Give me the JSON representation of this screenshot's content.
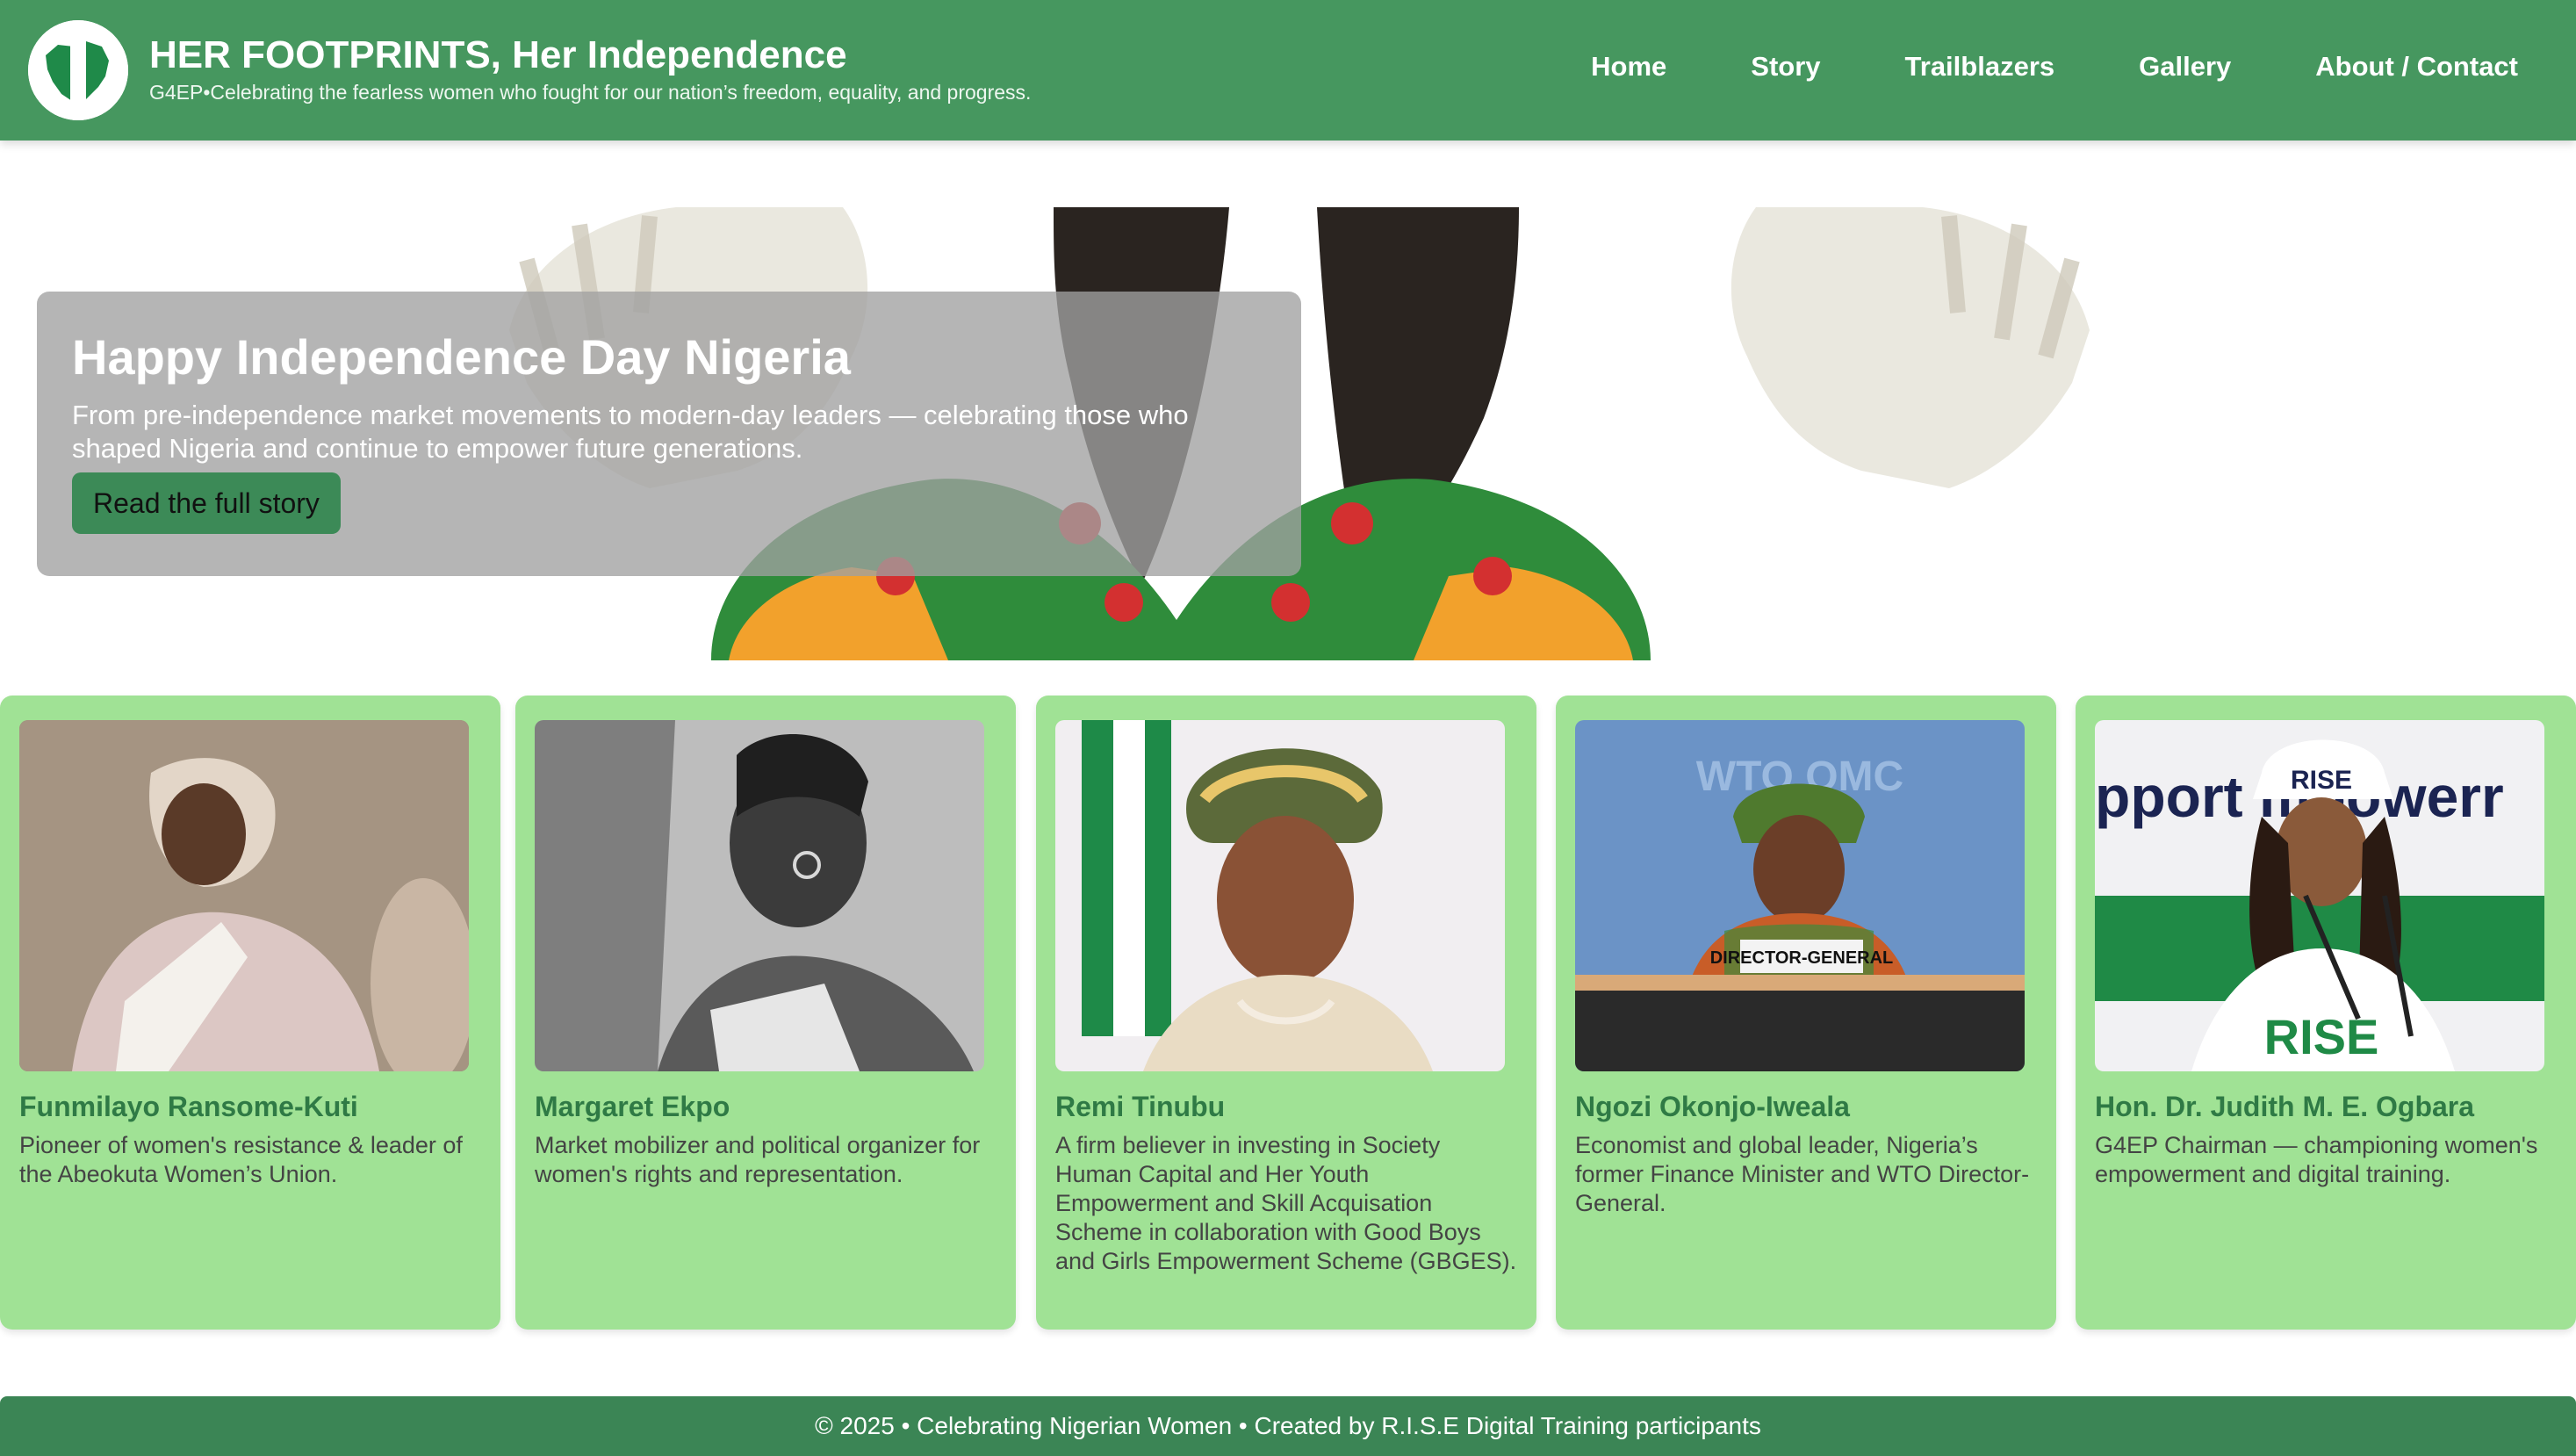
{
  "header": {
    "title": "HER FOOTPRINTS, Her Independence",
    "tagline": "G4EP•Celebrating the fearless women who fought for our nation’s freedom, equality, and progress.",
    "logo_icon": "nigeria-map-icon"
  },
  "nav": {
    "items": [
      {
        "label": "Home"
      },
      {
        "label": "Story"
      },
      {
        "label": "Trailblazers"
      },
      {
        "label": "Gallery"
      },
      {
        "label": "About / Contact"
      }
    ]
  },
  "hero": {
    "title": "Happy Independence Day Nigeria",
    "text": "From pre-independence market movements to modern-day leaders — celebrating those who shaped Nigeria and continue to empower future generations.",
    "button_label": "Read the full story",
    "image": "nigeria-coat-of-arms"
  },
  "cards": [
    {
      "name": "Funmilayo Ransome-Kuti",
      "desc": "Pioneer of women's resistance & leader of the Abeokuta Women’s Union."
    },
    {
      "name": "Margaret Ekpo",
      "desc": "Market mobilizer and political organizer for women's rights and representation."
    },
    {
      "name": "Remi Tinubu",
      "desc": "A firm believer in investing in Society Human Capital and Her Youth Empowerment and Skill Acquisation Scheme in collaboration with Good Boys and Girls Empowerment Scheme (GBGES)."
    },
    {
      "name": "Ngozi Okonjo-Iweala",
      "desc": "Economist and global leader, Nigeria’s former Finance Minister and WTO Director-General."
    },
    {
      "name": "Hon. Dr. Judith M. E. Ogbara",
      "desc": "G4EP Chairman — championing women's empowerment and digital training."
    }
  ],
  "photo_labels": {
    "wto_sign": "DIRECTOR-GENERAL",
    "wto_banner": "WTO OMC",
    "rise_banner": "pport  mpowerr",
    "rise_cap": "RISE",
    "rise_shirt": "RISE"
  },
  "footer": {
    "text": "© 2025 • Celebrating Nigerian Women • Created by R.I.S.E Digital Training participants"
  },
  "colors": {
    "header": "#46975f",
    "card": "#a0e295",
    "name": "#2f7a45",
    "footer": "#3b8555",
    "button": "#3c8a57"
  }
}
